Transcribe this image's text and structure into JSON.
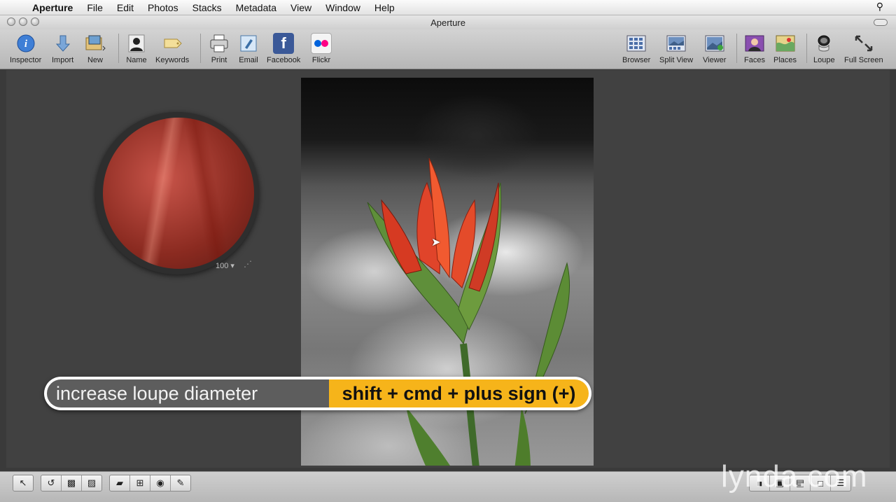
{
  "menubar": {
    "app_name": "Aperture",
    "items": [
      "File",
      "Edit",
      "Photos",
      "Stacks",
      "Metadata",
      "View",
      "Window",
      "Help"
    ]
  },
  "window": {
    "title": "Aperture"
  },
  "toolbar": {
    "inspector": "Inspector",
    "import": "Import",
    "new": "New",
    "name": "Name",
    "keywords": "Keywords",
    "print": "Print",
    "email": "Email",
    "facebook": "Facebook",
    "flickr": "Flickr",
    "browser": "Browser",
    "split_view": "Split View",
    "viewer": "Viewer",
    "faces": "Faces",
    "places": "Places",
    "loupe": "Loupe",
    "full_screen": "Full Screen"
  },
  "loupe": {
    "zoom": "100 ▾"
  },
  "shortcut": {
    "action": "increase loupe diameter",
    "keys": "shift + cmd + plus sign (+)"
  },
  "watermark": "lynda.com",
  "colors": {
    "accent": "#f6b41a",
    "facebook": "#3b5998"
  },
  "icons": {
    "inspector": "info-icon",
    "import": "arrow-down-icon",
    "new": "folder-icon",
    "name": "person-icon",
    "keywords": "tag-icon",
    "print": "printer-icon",
    "email": "envelope-icon",
    "facebook": "facebook-icon",
    "flickr": "flickr-icon",
    "browser": "grid-icon",
    "split_view": "split-view-icon",
    "viewer": "viewer-icon",
    "faces": "faces-icon",
    "places": "places-icon",
    "loupe": "loupe-icon",
    "full_screen": "fullscreen-icon"
  }
}
